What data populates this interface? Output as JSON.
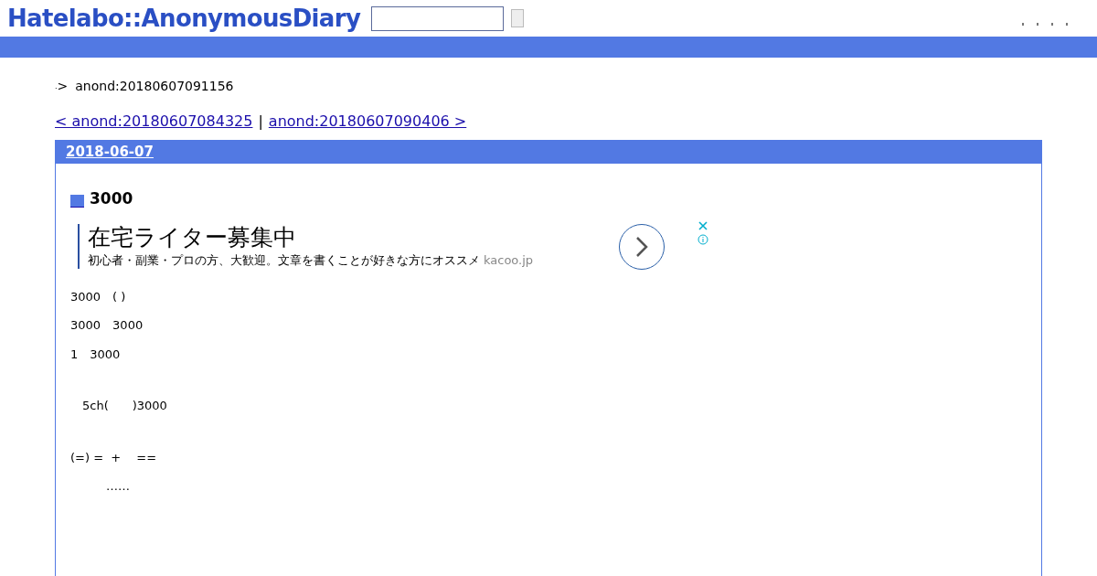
{
  "header": {
    "logo": "Hatelabo::AnonymousDiary"
  },
  "breadcrumb": {
    "home": ".",
    "separator": ">",
    "current": "anond:20180607091156"
  },
  "pager": {
    "prev": "< anond:20180607084325",
    "separator": "|",
    "next": "anond:20180607090406 >"
  },
  "day": {
    "date": "2018-06-07",
    "title": "3000",
    "ad": {
      "headline": "在宅ライター募集中",
      "body": "初心者・副業・プロの方、大歓迎。文章を書くことが好きな方にオススメ",
      "domain": "kacoo.jp"
    },
    "sections": [
      [
        "3000　( )",
        "3000　3000",
        "1　3000"
      ],
      [
        "　5ch(　　)3000"
      ],
      [
        "(=) =  +　 ==",
        "　　　……"
      ]
    ]
  }
}
